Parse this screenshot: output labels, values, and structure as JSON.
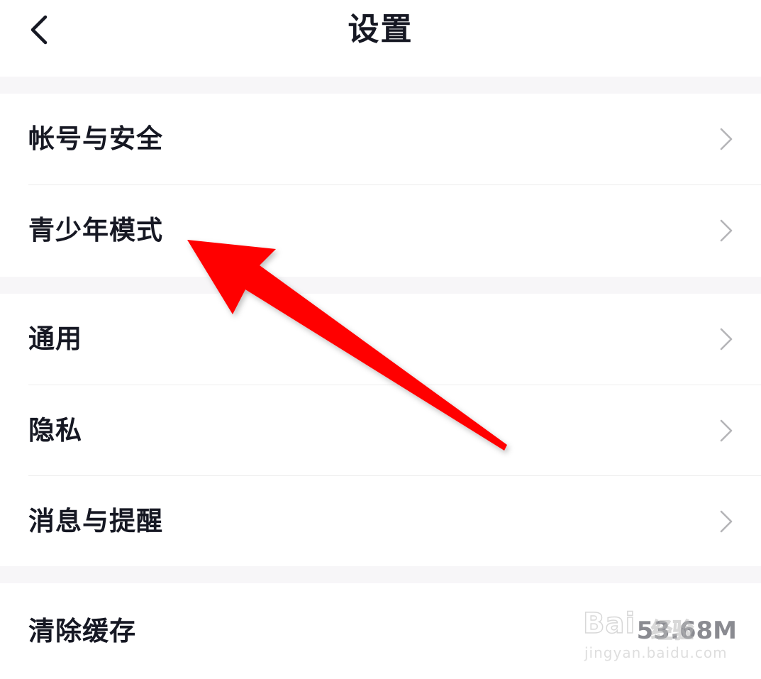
{
  "header": {
    "title": "设置",
    "back_icon": "chevron-left-icon"
  },
  "groups": [
    {
      "items": [
        {
          "label": "帐号与安全",
          "icon": "chevron-right-icon"
        },
        {
          "label": "青少年模式",
          "icon": "chevron-right-icon"
        }
      ]
    },
    {
      "items": [
        {
          "label": "通用",
          "icon": "chevron-right-icon"
        },
        {
          "label": "隐私",
          "icon": "chevron-right-icon"
        },
        {
          "label": "消息与提醒",
          "icon": "chevron-right-icon"
        }
      ]
    },
    {
      "items": [
        {
          "label": "清除缓存",
          "value": "53.68M"
        }
      ]
    }
  ],
  "annotation": {
    "type": "arrow",
    "color": "#ff0000",
    "points_to": "青少年模式"
  },
  "watermark": {
    "brand": "Bai",
    "brand_suffix": "经验",
    "url": "jingyan.baidu.com"
  },
  "colors": {
    "background": "#f7f6f8",
    "surface": "#ffffff",
    "text_primary": "#161823",
    "text_secondary": "#8a8b91",
    "chevron": "#b5b5b8",
    "divider": "#ededed",
    "arrow": "#ff0000"
  }
}
